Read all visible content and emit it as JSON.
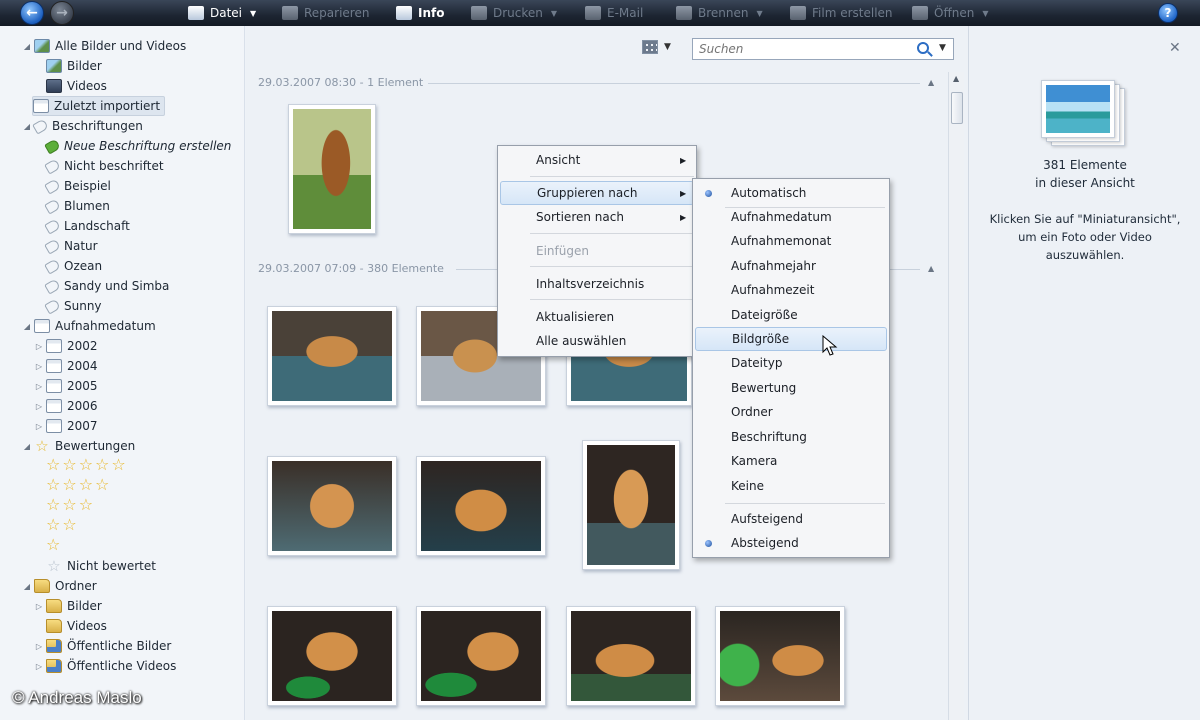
{
  "toolbar": {
    "items": [
      {
        "label": "Datei",
        "icon": "file-icon",
        "active": true,
        "dropdown": true
      },
      {
        "label": "Reparieren",
        "icon": "fix-icon",
        "active": false,
        "dropdown": false
      },
      {
        "label": "Info",
        "icon": "info-icon",
        "active": true,
        "dropdown": false
      },
      {
        "label": "Drucken",
        "icon": "printer-icon",
        "active": false,
        "dropdown": true
      },
      {
        "label": "E-Mail",
        "icon": "mail-icon",
        "active": false,
        "dropdown": false
      },
      {
        "label": "Brennen",
        "icon": "disc-icon",
        "active": false,
        "dropdown": true
      },
      {
        "label": "Film erstellen",
        "icon": "film-icon",
        "active": false,
        "dropdown": false
      },
      {
        "label": "Öffnen",
        "icon": "open-icon",
        "active": false,
        "dropdown": true
      }
    ],
    "help": "?"
  },
  "tree": {
    "all": "Alle Bilder und Videos",
    "pictures": "Bilder",
    "videos": "Videos",
    "recent": "Zuletzt importiert",
    "tags": "Beschriftungen",
    "new_tag": "Neue Beschriftung erstellen",
    "untagged": "Nicht beschriftet",
    "tag_list": [
      "Beispiel",
      "Blumen",
      "Landschaft",
      "Natur",
      "Ozean",
      "Sandy und Simba",
      "Sunny"
    ],
    "date_taken": "Aufnahmedatum",
    "years": [
      "2002",
      "2004",
      "2005",
      "2006",
      "2007"
    ],
    "ratings": "Bewertungen",
    "rating_levels": [
      5,
      4,
      3,
      2,
      1
    ],
    "not_rated": "Nicht bewertet",
    "folders": "Ordner",
    "folder_list": [
      "Bilder",
      "Videos",
      "Öffentliche Bilder",
      "Öffentliche Videos"
    ]
  },
  "search": {
    "placeholder": "Suchen"
  },
  "groups": [
    {
      "header": "29.03.2007 08:30 - 1 Element"
    },
    {
      "header": "29.03.2007 07:09 - 380 Elemente"
    }
  ],
  "context_menu": {
    "items": [
      "Ansicht",
      "Gruppieren nach",
      "Sortieren nach",
      "Einfügen",
      "Inhaltsverzeichnis",
      "Aktualisieren",
      "Alle auswählen"
    ]
  },
  "submenu": {
    "items": [
      "Automatisch",
      "Aufnahmedatum",
      "Aufnahmemonat",
      "Aufnahmejahr",
      "Aufnahmezeit",
      "Dateigröße",
      "Bildgröße",
      "Dateityp",
      "Bewertung",
      "Ordner",
      "Beschriftung",
      "Kamera",
      "Keine"
    ],
    "order": [
      "Aufsteigend",
      "Absteigend"
    ],
    "selected_group": "Automatisch",
    "selected_order": "Absteigend",
    "hovered": "Bildgröße"
  },
  "info_panel": {
    "count_line1": "381 Elemente",
    "count_line2": "in dieser Ansicht",
    "hint_line1": "Klicken Sie auf \"Miniaturansicht\",",
    "hint_line2": "um ein Foto oder Video",
    "hint_line3": "auszuwählen."
  },
  "watermark": "© Andreas Maslo",
  "colors": {
    "toolbar": "#1d2532",
    "accent": "#2c6dc4",
    "star": "#e8b82e",
    "highlight": "#d6e6f7"
  }
}
